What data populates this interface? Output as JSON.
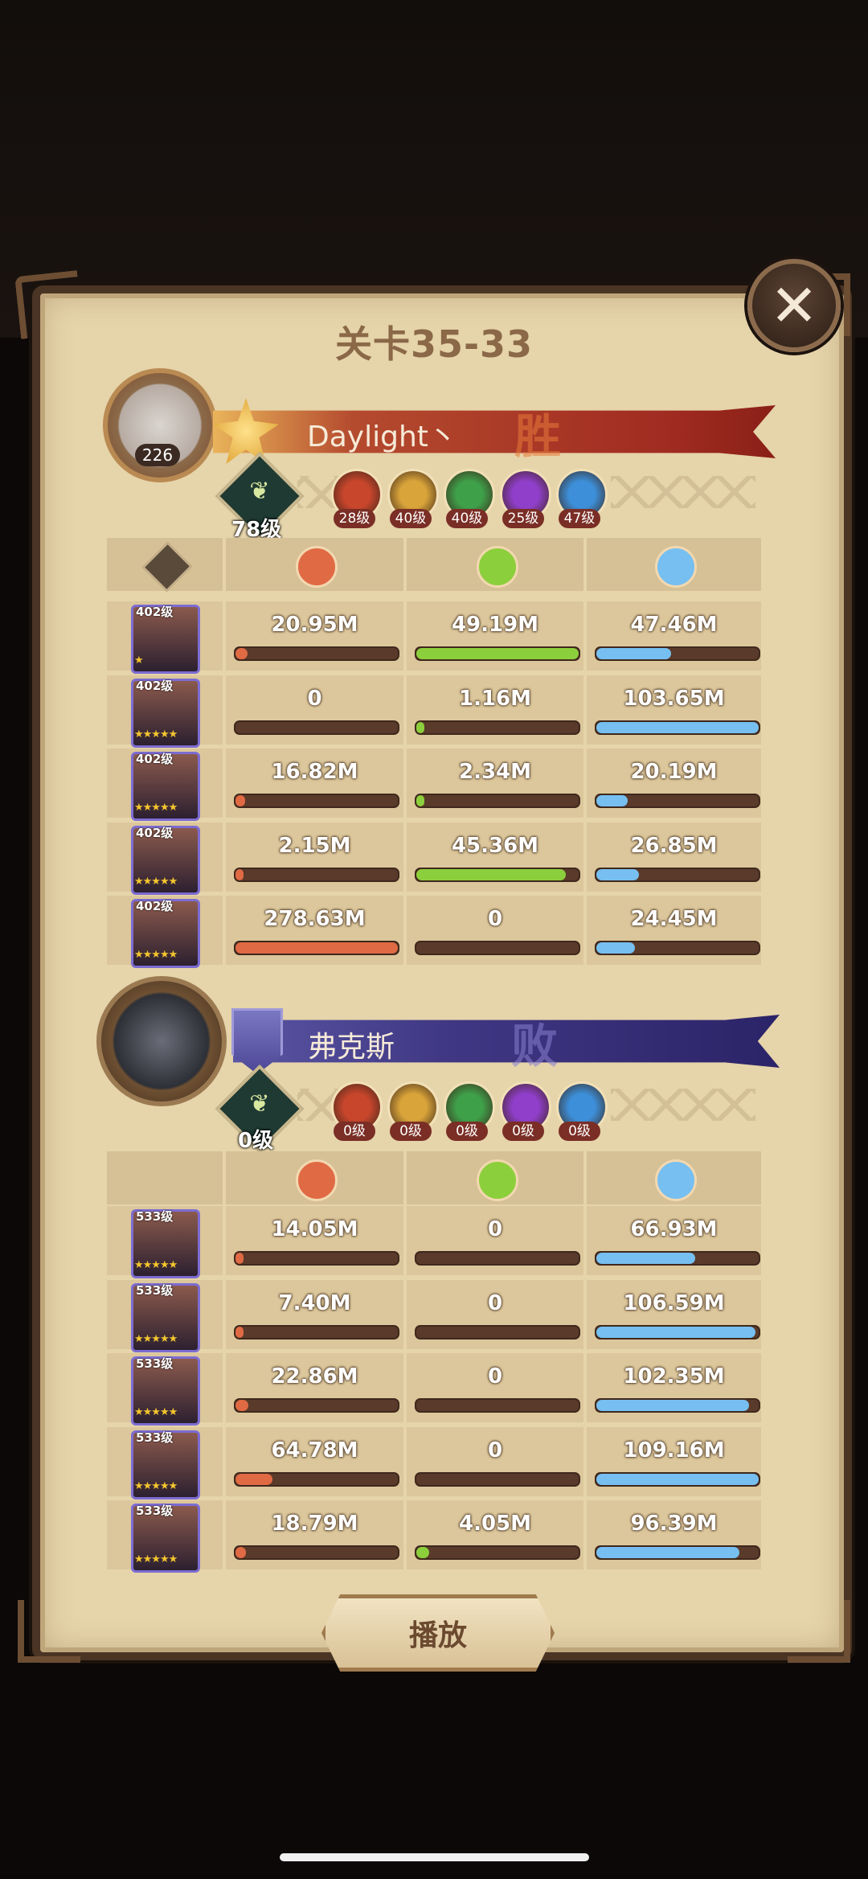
{
  "title": "关卡35-33",
  "close_label": "✕",
  "play_label": "播放",
  "colors": {
    "damage": "#e06a44",
    "heal": "#8ccf3c",
    "shield": "#76bff0"
  },
  "team1": {
    "name": "Daylight丶",
    "result": "胜",
    "avatar_level": "226",
    "tree_level": "78级",
    "faction_levels": [
      "28级",
      "40级",
      "40级",
      "25级",
      "47级"
    ],
    "heroes": [
      {
        "level": "402级",
        "stars": "★",
        "damage": "20.95M",
        "heal": "49.19M",
        "shield": "47.46M",
        "dmg_pct": 0.075,
        "heal_pct": 1.0,
        "shield_pct": 0.46
      },
      {
        "level": "402级",
        "stars": "★★★★★",
        "damage": "0",
        "heal": "1.16M",
        "shield": "103.65M",
        "dmg_pct": 0,
        "heal_pct": 0.024,
        "shield_pct": 1.0
      },
      {
        "level": "402级",
        "stars": "★★★★★",
        "damage": "16.82M",
        "heal": "2.34M",
        "shield": "20.19M",
        "dmg_pct": 0.06,
        "heal_pct": 0.048,
        "shield_pct": 0.195
      },
      {
        "level": "402级",
        "stars": "★★★★★",
        "damage": "2.15M",
        "heal": "45.36M",
        "shield": "26.85M",
        "dmg_pct": 0.008,
        "heal_pct": 0.92,
        "shield_pct": 0.26
      },
      {
        "level": "402级",
        "stars": "★★★★★",
        "damage": "278.63M",
        "heal": "0",
        "shield": "24.45M",
        "dmg_pct": 1.0,
        "heal_pct": 0,
        "shield_pct": 0.236
      }
    ]
  },
  "team2": {
    "name": "弗克斯",
    "result": "败",
    "tree_level": "0级",
    "faction_levels": [
      "0级",
      "0级",
      "0级",
      "0级",
      "0级"
    ],
    "heroes": [
      {
        "level": "533级",
        "stars": "★★★★★",
        "damage": "14.05M",
        "heal": "0",
        "shield": "66.93M",
        "dmg_pct": 0.05,
        "heal_pct": 0,
        "shield_pct": 0.61
      },
      {
        "level": "533级",
        "stars": "★★★★★",
        "damage": "7.40M",
        "heal": "0",
        "shield": "106.59M",
        "dmg_pct": 0.03,
        "heal_pct": 0,
        "shield_pct": 0.98
      },
      {
        "level": "533级",
        "stars": "★★★★★",
        "damage": "22.86M",
        "heal": "0",
        "shield": "102.35M",
        "dmg_pct": 0.08,
        "heal_pct": 0,
        "shield_pct": 0.94
      },
      {
        "level": "533级",
        "stars": "★★★★★",
        "damage": "64.78M",
        "heal": "0",
        "shield": "109.16M",
        "dmg_pct": 0.23,
        "heal_pct": 0,
        "shield_pct": 1.0
      },
      {
        "level": "533级",
        "stars": "★★★★★",
        "damage": "18.79M",
        "heal": "4.05M",
        "shield": "96.39M",
        "dmg_pct": 0.065,
        "heal_pct": 0.08,
        "shield_pct": 0.88
      }
    ]
  }
}
